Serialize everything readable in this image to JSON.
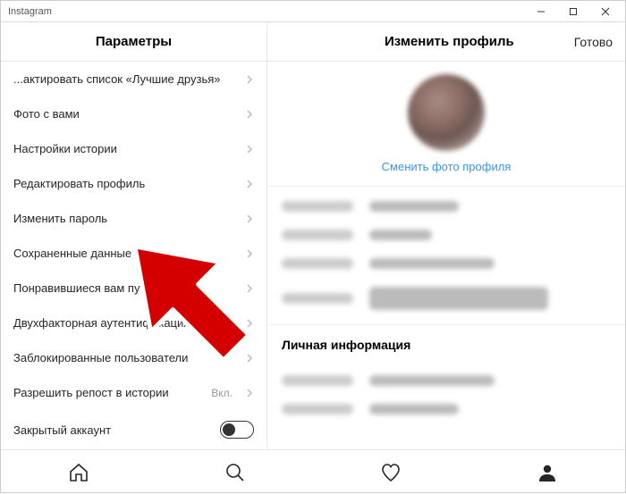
{
  "window": {
    "title": "Instagram"
  },
  "sidebar": {
    "header": "Параметры",
    "items": [
      {
        "label": "...актировать список «Лучшие друзья»",
        "type": "link"
      },
      {
        "label": "Фото с вами",
        "type": "link"
      },
      {
        "label": "Настройки истории",
        "type": "link"
      },
      {
        "label": "Редактировать профиль",
        "type": "link"
      },
      {
        "label": "Изменить пароль",
        "type": "link"
      },
      {
        "label": "Сохраненные данные",
        "type": "link"
      },
      {
        "label": "Понравившиеся вам публикации",
        "type": "link"
      },
      {
        "label": "Двухфакторная аутентификация",
        "type": "link"
      },
      {
        "label": "Заблокированные пользователи",
        "type": "link"
      },
      {
        "label": "Разрешить репост в истории",
        "type": "switch-label",
        "trail": "Вкл."
      },
      {
        "label": "Закрытый аккаунт",
        "type": "toggle"
      }
    ]
  },
  "main": {
    "title": "Изменить профиль",
    "done": "Готово",
    "change_photo": "Сменить фото профиля",
    "section_personal": "Личная информация"
  },
  "nav": {
    "home": "home-icon",
    "search": "search-icon",
    "activity": "heart-icon",
    "profile": "profile-icon"
  },
  "annotation": {
    "arrow_target": "Изменить пароль"
  }
}
